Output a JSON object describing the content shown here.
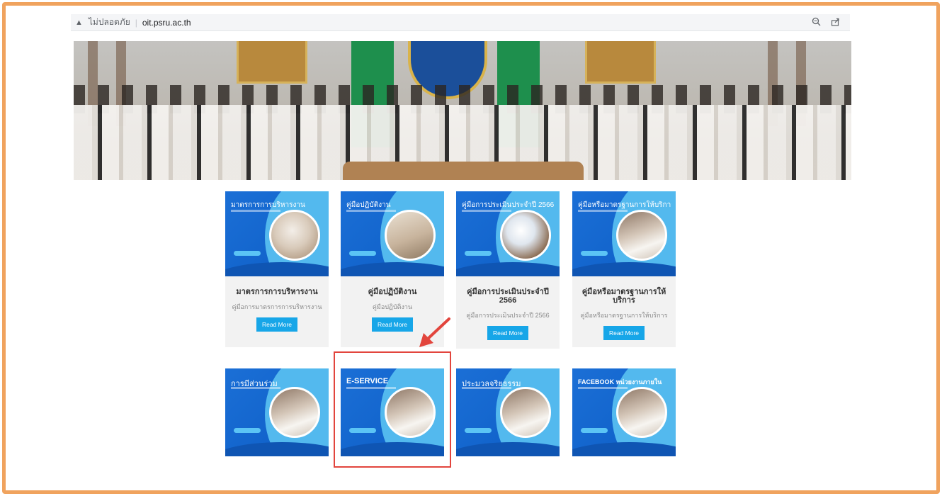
{
  "browser": {
    "warning_icon": "warning-triangle-icon",
    "insecure_label": "ไม่ปลอดภัย",
    "separator": "|",
    "url": "oit.psru.ac.th",
    "icons": [
      "zoom-icon",
      "share-icon"
    ]
  },
  "banner": {
    "alt": "staff-group-photo"
  },
  "cards_row1": [
    {
      "image_title": "มาตรการการบริหารงาน",
      "title": "มาตรการการบริหารงาน",
      "desc": "คู่มือการมาตรการการบริหารงาน",
      "button": "Read More"
    },
    {
      "image_title": "คู่มือปฏิบัติงาน",
      "title": "คู่มือปฏิบัติงาน",
      "desc": "คู่มือปฏิบัติงาน",
      "button": "Read More"
    },
    {
      "image_title": "คู่มือการประเมินประจำปี 2566",
      "title": "คู่มือการประเมินประจำปี 2566",
      "desc": "คู่มือการประเมินประจำปี 2566",
      "button": "Read More"
    },
    {
      "image_title": "คู่มือหรือมาตรฐานการให้บริการ",
      "title": "คู่มือหรือมาตรฐานการให้บริการ",
      "desc": "คู่มือหรือมาตรฐานการให้บริการ",
      "button": "Read More"
    }
  ],
  "cards_row2": [
    {
      "image_title": "การมีส่วนร่วม"
    },
    {
      "image_title": "E-SERVICE"
    },
    {
      "image_title": "ประมวลจริยธรรม"
    },
    {
      "image_title": "FACEBOOK หน่วยงานภายใน"
    }
  ],
  "colors": {
    "frame": "#f0a35e",
    "card_blue": "#1264cc",
    "card_light_blue": "#53b9ee",
    "button": "#17a6e8",
    "highlight": "#e2453d"
  }
}
